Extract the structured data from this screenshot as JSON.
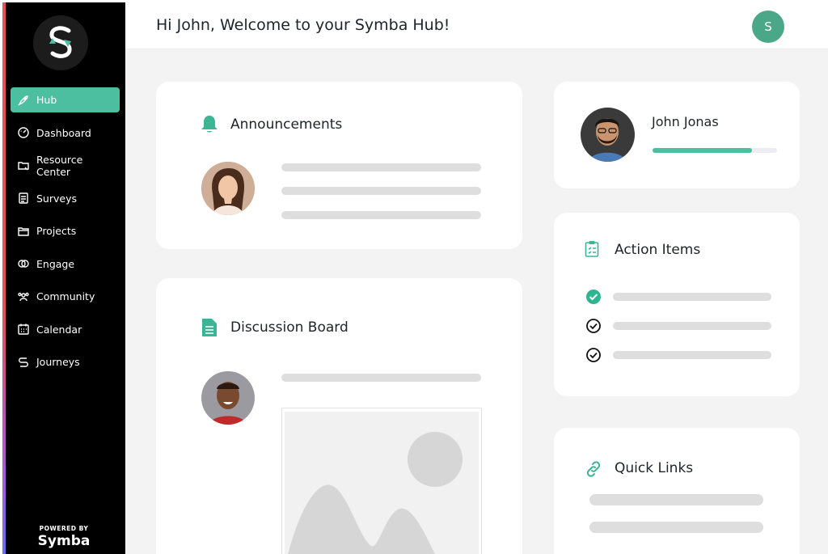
{
  "header": {
    "greeting": "Hi John, Welcome to your Symba Hub!",
    "avatar_initial": "S"
  },
  "sidebar": {
    "items": [
      {
        "label": "Hub",
        "icon": "rocket-icon",
        "active": true
      },
      {
        "label": "Dashboard",
        "icon": "gauge-icon"
      },
      {
        "label": "Resource Center",
        "icon": "folder-link-icon"
      },
      {
        "label": "Surveys",
        "icon": "clipboard-list-icon"
      },
      {
        "label": "Projects",
        "icon": "folder-icon"
      },
      {
        "label": "Engage",
        "icon": "rings-icon"
      },
      {
        "label": "Community",
        "icon": "users-icon"
      },
      {
        "label": "Calendar",
        "icon": "calendar-icon"
      },
      {
        "label": "Journeys",
        "icon": "journey-s-icon"
      }
    ],
    "powered_by": "POWERED BY",
    "brand": "Symba"
  },
  "announcements": {
    "title": "Announcements",
    "icon": "bell-icon"
  },
  "discussion": {
    "title": "Discussion Board",
    "icon": "document-icon"
  },
  "profile": {
    "name": "John Jonas",
    "progress": 0.8
  },
  "action_items": {
    "title": "Action Items",
    "icon": "clipboard-check-icon",
    "items": [
      {
        "done": true
      },
      {
        "done": false
      },
      {
        "done": false
      }
    ]
  },
  "quick_links": {
    "title": "Quick Links",
    "icon": "link-icon"
  },
  "colors": {
    "accent": "#4cbfa0",
    "avatar": "#4aa888",
    "background": "#f3f3f3",
    "sidebar": "#000000"
  }
}
